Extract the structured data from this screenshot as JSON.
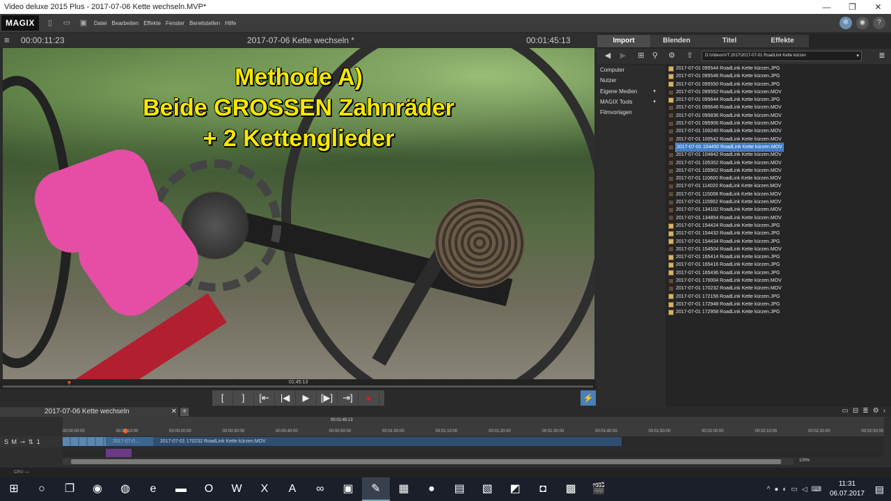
{
  "window": {
    "title": "Video deluxe 2015 Plus - 2017-07-06 Kette wechseln.MVP*",
    "controls": [
      "—",
      "❐",
      "✕"
    ]
  },
  "menubar": {
    "logo": "MAGIX",
    "items": [
      "Datei",
      "Bearbeiten",
      "Effekte",
      "Fenster",
      "Bereitstellen",
      "Hilfe"
    ]
  },
  "preview": {
    "timecode_left": "00:00:11:23",
    "project_title": "2017-07-06 Kette wechseln *",
    "timecode_right": "00:01:45:13",
    "caption_lines": [
      "Methode A)",
      "Beide GROSSEN Zahnräder",
      "+ 2 Kettenglieder"
    ],
    "scrub_timecode": "01:45:13",
    "transport": [
      "[",
      "]",
      "[⇤",
      "|◀",
      "▶",
      "[▶]",
      "⇥]",
      "●"
    ]
  },
  "media_panel": {
    "tabs": [
      "Import",
      "Blenden",
      "Titel",
      "Effekte"
    ],
    "active_tab": "Import",
    "path": "D:\\Videos\\VT 2017\\2017-07-01 RoadLink Kette kürzen",
    "nav": [
      {
        "label": "Computer",
        "expand": false
      },
      {
        "label": "Nutzer",
        "expand": false
      },
      {
        "label": "Eigene Medien",
        "expand": true
      },
      {
        "label": "MAGIX Tools",
        "expand": true
      },
      {
        "label": "Filmvorlagen",
        "expand": false
      }
    ],
    "files": [
      {
        "name": "2017-07-01 095544 RoadLink Kette kürzen.JPG",
        "type": "jpg"
      },
      {
        "name": "2017-07-01 095546 RoadLink Kette kürzen.JPG",
        "type": "jpg"
      },
      {
        "name": "2017-07-01 095550 RoadLink Kette kürzen.JPG",
        "type": "jpg"
      },
      {
        "name": "2017-07-01 095552 RoadLink Kette kürzen.MOV",
        "type": "mov"
      },
      {
        "name": "2017-07-01 095644 RoadLink Kette kürzen.JPG",
        "type": "jpg"
      },
      {
        "name": "2017-07-01 095646 RoadLink Kette kürzen.MOV",
        "type": "mov"
      },
      {
        "name": "2017-07-01 095836 RoadLink Kette kürzen.MOV",
        "type": "mov"
      },
      {
        "name": "2017-07-01 095906 RoadLink Kette kürzen.MOV",
        "type": "mov"
      },
      {
        "name": "2017-07-01 100240 RoadLink Kette kürzen.MOV",
        "type": "mov"
      },
      {
        "name": "2017-07-01 100542 RoadLink Kette kürzen.MOV",
        "type": "mov"
      },
      {
        "name": "2017-07-01 104450 RoadLink Kette kürzen.MOV",
        "type": "mov",
        "selected": true
      },
      {
        "name": "2017-07-01 104842 RoadLink Kette kürzen.MOV",
        "type": "mov"
      },
      {
        "name": "2017-07-01 105352 RoadLink Kette kürzen.MOV",
        "type": "mov"
      },
      {
        "name": "2017-07-01 105902 RoadLink Kette kürzen.MOV",
        "type": "mov"
      },
      {
        "name": "2017-07-01 110600 RoadLink Kette kürzen.MOV",
        "type": "mov"
      },
      {
        "name": "2017-07-01 114020 RoadLink Kette kürzen.MOV",
        "type": "mov"
      },
      {
        "name": "2017-07-01 115008 RoadLink Kette kürzen.MOV",
        "type": "mov"
      },
      {
        "name": "2017-07-01 115902 RoadLink Kette kürzen.MOV",
        "type": "mov"
      },
      {
        "name": "2017-07-01 134102 RoadLink Kette kürzen.MOV",
        "type": "mov"
      },
      {
        "name": "2017-07-01 134854 RoadLink Kette kürzen.MOV",
        "type": "mov"
      },
      {
        "name": "2017-07-01 154424 RoadLink Kette kürzen.JPG",
        "type": "jpg"
      },
      {
        "name": "2017-07-01 154432 RoadLink Kette kürzen.JPG",
        "type": "jpg"
      },
      {
        "name": "2017-07-01 154434 RoadLink Kette kürzen.JPG",
        "type": "jpg"
      },
      {
        "name": "2017-07-01 154504 RoadLink Kette kürzen.MOV",
        "type": "mov"
      },
      {
        "name": "2017-07-01 165414 RoadLink Kette kürzen.JPG",
        "type": "jpg"
      },
      {
        "name": "2017-07-01 165416 RoadLink Kette kürzen.JPG",
        "type": "jpg"
      },
      {
        "name": "2017-07-01 165436 RoadLink Kette kürzen.JPG",
        "type": "jpg"
      },
      {
        "name": "2017-07-01 170004 RoadLink Kette kürzen.MOV",
        "type": "mov"
      },
      {
        "name": "2017-07-01 170232 RoadLink Kette kürzen.MOV",
        "type": "mov"
      },
      {
        "name": "2017-07-01 172156 RoadLink Kette kürzen.JPG",
        "type": "jpg"
      },
      {
        "name": "2017-07-01 172948 RoadLink Kette kürzen.JPG",
        "type": "jpg"
      },
      {
        "name": "2017-07-01 172958 RoadLink Kette kürzen.JPG",
        "type": "jpg"
      }
    ]
  },
  "timeline": {
    "tab_label": "2017-07-06 Kette wechseln",
    "close": "✕",
    "add": "+",
    "ruler_center": "00:01:45:13",
    "ticks": [
      "00:00:00:00",
      "00:00:10:00",
      "00:00:20:00",
      "00:00:30:00",
      "00:00:40:00",
      "00:00:50:00",
      "00:01:00:00",
      "00:01:10:00",
      "00:01:20:00",
      "00:01:30:00",
      "00:01:40:00",
      "00:01:50:00",
      "00:02:00:00",
      "00:02:10:00",
      "00:02:20:00",
      "00:02:30:00"
    ],
    "track_header": "S M ⊸ ⇅ 1",
    "clip_a": "2017-07-0…",
    "clip_b": "2017-07-01 170232 RoadLink Kette kürzen.MOV",
    "zoom": "100%"
  },
  "status": {
    "cpu": "CPU: —"
  },
  "taskbar": {
    "time": "11:31",
    "date": "06.07.2017"
  }
}
